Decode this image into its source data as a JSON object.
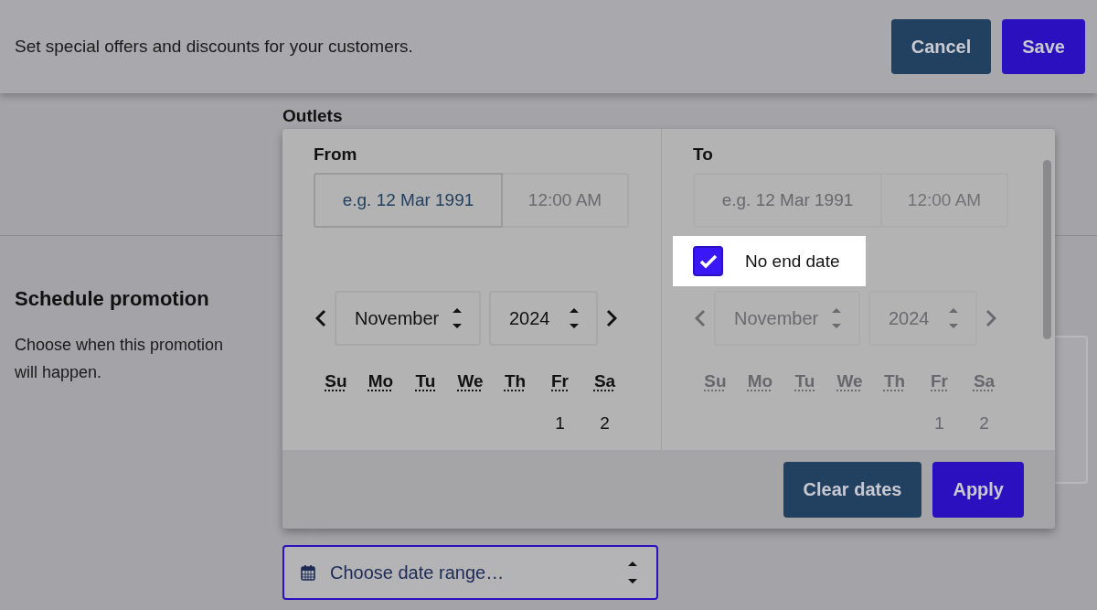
{
  "header": {
    "description": "Set special offers and discounts for your customers.",
    "buttons": [
      {
        "label": "Cancel",
        "kind": "secondary"
      },
      {
        "label": "Save",
        "kind": "primary"
      }
    ]
  },
  "outlets": {
    "label": "Outlets"
  },
  "schedule": {
    "title": "Schedule promotion",
    "description": "Choose when this promotion will happen."
  },
  "date_picker": {
    "columns": [
      {
        "label": "From",
        "disabled": false,
        "date_placeholder": "e.g. 12 Mar 1991",
        "date_focused": true,
        "time_placeholder": "12:00 AM",
        "month": "November",
        "year": "2024",
        "weekdays": [
          "Su",
          "Mo",
          "Tu",
          "We",
          "Th",
          "Fr",
          "Sa"
        ],
        "days": [
          "1",
          "2"
        ]
      },
      {
        "label": "To",
        "disabled": true,
        "date_placeholder": "e.g. 12 Mar 1991",
        "date_focused": false,
        "time_placeholder": "12:00 AM",
        "month": "November",
        "year": "2024",
        "weekdays": [
          "Su",
          "Mo",
          "Tu",
          "We",
          "Th",
          "Fr",
          "Sa"
        ],
        "days": [
          "1",
          "2"
        ]
      }
    ],
    "no_end_date": {
      "label": "No end date",
      "checked": true
    },
    "buttons": [
      {
        "label": "Clear dates",
        "kind": "secondary"
      },
      {
        "label": "Apply",
        "kind": "primary"
      }
    ]
  },
  "date_field": {
    "placeholder": "Choose date range…"
  }
}
